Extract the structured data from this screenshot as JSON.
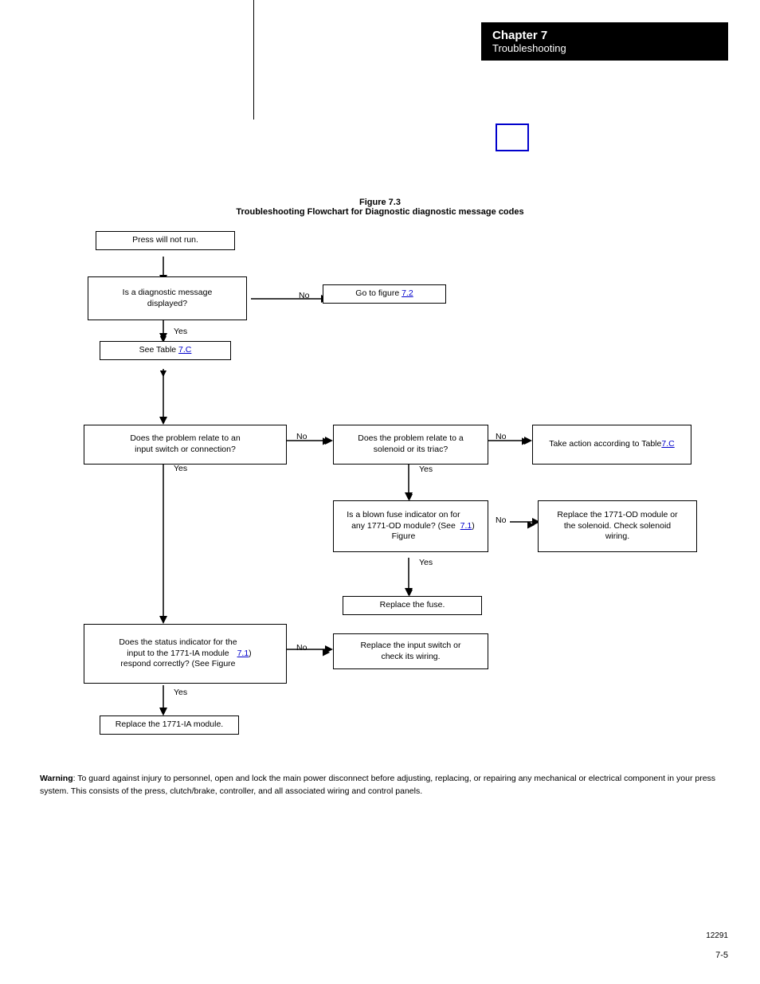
{
  "header": {
    "chapter_number": "Chapter 7",
    "chapter_title": "Troubleshooting"
  },
  "figure": {
    "number": "Figure 7.3",
    "description": "Troubleshooting Flowchart for Diagnostic diagnostic message codes"
  },
  "flowchart": {
    "boxes": {
      "press_not_run": "Press will not run.",
      "diagnostic_msg": "Is a diagnostic message\ndisplayed?",
      "go_to_figure": "Go to figure 7.2",
      "see_table": "See Table 7.C",
      "problem_input": "Does the problem relate to an\ninput switch or connection?",
      "problem_solenoid": "Does the problem relate to a\nsolenoid or its triac?",
      "take_action": "Take action according to Table\n7.C",
      "blown_fuse": "Is a blown fuse indicator on for\nany 1771-OD module? (See\nFigure 7.1)",
      "replace_1771od": "Replace the 1771-OD module or\nthe solenoid. Check solenoid\nwiring.",
      "replace_fuse": "Replace the fuse.",
      "status_indicator": "Does the status indicator for the\ninput to the 1771-IA module\nrespond correctly? (See Figure\n7.1)",
      "replace_input_switch": "Replace the input switch or\ncheck its wiring.",
      "replace_1771ia": "Replace the 1771-IA module."
    },
    "labels": {
      "no1": "No",
      "no2": "No",
      "no3": "No",
      "no4": "No",
      "yes1": "Yes",
      "yes2": "Yes",
      "yes3": "Yes",
      "yes4": "Yes"
    }
  },
  "warning": {
    "label": "Warning",
    "text": ": To guard against injury to personnel, open and lock the main power disconnect before adjusting, replacing, or repairing any mechanical or electrical component in your press system.  This consists of the press, clutch/brake, controller, and all associated wiring and control panels."
  },
  "doc_number": "12291",
  "page_number": "7-5"
}
